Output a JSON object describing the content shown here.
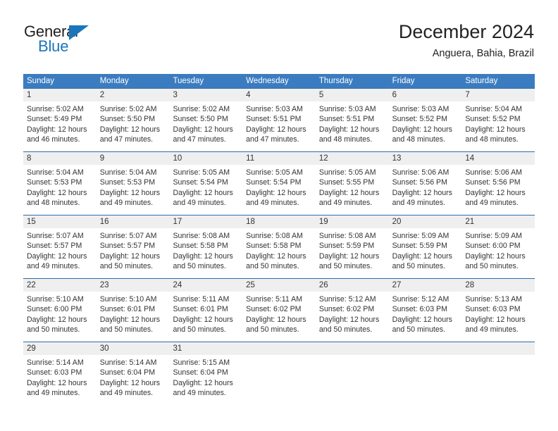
{
  "brand": {
    "name_part1": "General",
    "name_part2": "Blue",
    "triangle_color": "#1b75bb"
  },
  "header": {
    "title": "December 2024",
    "location": "Anguera, Bahia, Brazil"
  },
  "theme": {
    "header_blue": "#3b7cc0",
    "separator_blue": "#2f6cab",
    "daynum_band": "#efefef",
    "text": "#333333"
  },
  "weekdays": [
    "Sunday",
    "Monday",
    "Tuesday",
    "Wednesday",
    "Thursday",
    "Friday",
    "Saturday"
  ],
  "labels": {
    "sunrise_prefix": "Sunrise: ",
    "sunset_prefix": "Sunset: ",
    "daylight_prefix": "Daylight: "
  },
  "weeks": [
    {
      "days": [
        {
          "num": "1",
          "sunrise": "Sunrise: 5:02 AM",
          "sunset": "Sunset: 5:49 PM",
          "daylight_a": "Daylight: 12 hours",
          "daylight_b": "and 46 minutes."
        },
        {
          "num": "2",
          "sunrise": "Sunrise: 5:02 AM",
          "sunset": "Sunset: 5:50 PM",
          "daylight_a": "Daylight: 12 hours",
          "daylight_b": "and 47 minutes."
        },
        {
          "num": "3",
          "sunrise": "Sunrise: 5:02 AM",
          "sunset": "Sunset: 5:50 PM",
          "daylight_a": "Daylight: 12 hours",
          "daylight_b": "and 47 minutes."
        },
        {
          "num": "4",
          "sunrise": "Sunrise: 5:03 AM",
          "sunset": "Sunset: 5:51 PM",
          "daylight_a": "Daylight: 12 hours",
          "daylight_b": "and 47 minutes."
        },
        {
          "num": "5",
          "sunrise": "Sunrise: 5:03 AM",
          "sunset": "Sunset: 5:51 PM",
          "daylight_a": "Daylight: 12 hours",
          "daylight_b": "and 48 minutes."
        },
        {
          "num": "6",
          "sunrise": "Sunrise: 5:03 AM",
          "sunset": "Sunset: 5:52 PM",
          "daylight_a": "Daylight: 12 hours",
          "daylight_b": "and 48 minutes."
        },
        {
          "num": "7",
          "sunrise": "Sunrise: 5:04 AM",
          "sunset": "Sunset: 5:52 PM",
          "daylight_a": "Daylight: 12 hours",
          "daylight_b": "and 48 minutes."
        }
      ]
    },
    {
      "days": [
        {
          "num": "8",
          "sunrise": "Sunrise: 5:04 AM",
          "sunset": "Sunset: 5:53 PM",
          "daylight_a": "Daylight: 12 hours",
          "daylight_b": "and 48 minutes."
        },
        {
          "num": "9",
          "sunrise": "Sunrise: 5:04 AM",
          "sunset": "Sunset: 5:53 PM",
          "daylight_a": "Daylight: 12 hours",
          "daylight_b": "and 49 minutes."
        },
        {
          "num": "10",
          "sunrise": "Sunrise: 5:05 AM",
          "sunset": "Sunset: 5:54 PM",
          "daylight_a": "Daylight: 12 hours",
          "daylight_b": "and 49 minutes."
        },
        {
          "num": "11",
          "sunrise": "Sunrise: 5:05 AM",
          "sunset": "Sunset: 5:54 PM",
          "daylight_a": "Daylight: 12 hours",
          "daylight_b": "and 49 minutes."
        },
        {
          "num": "12",
          "sunrise": "Sunrise: 5:05 AM",
          "sunset": "Sunset: 5:55 PM",
          "daylight_a": "Daylight: 12 hours",
          "daylight_b": "and 49 minutes."
        },
        {
          "num": "13",
          "sunrise": "Sunrise: 5:06 AM",
          "sunset": "Sunset: 5:56 PM",
          "daylight_a": "Daylight: 12 hours",
          "daylight_b": "and 49 minutes."
        },
        {
          "num": "14",
          "sunrise": "Sunrise: 5:06 AM",
          "sunset": "Sunset: 5:56 PM",
          "daylight_a": "Daylight: 12 hours",
          "daylight_b": "and 49 minutes."
        }
      ]
    },
    {
      "days": [
        {
          "num": "15",
          "sunrise": "Sunrise: 5:07 AM",
          "sunset": "Sunset: 5:57 PM",
          "daylight_a": "Daylight: 12 hours",
          "daylight_b": "and 49 minutes."
        },
        {
          "num": "16",
          "sunrise": "Sunrise: 5:07 AM",
          "sunset": "Sunset: 5:57 PM",
          "daylight_a": "Daylight: 12 hours",
          "daylight_b": "and 50 minutes."
        },
        {
          "num": "17",
          "sunrise": "Sunrise: 5:08 AM",
          "sunset": "Sunset: 5:58 PM",
          "daylight_a": "Daylight: 12 hours",
          "daylight_b": "and 50 minutes."
        },
        {
          "num": "18",
          "sunrise": "Sunrise: 5:08 AM",
          "sunset": "Sunset: 5:58 PM",
          "daylight_a": "Daylight: 12 hours",
          "daylight_b": "and 50 minutes."
        },
        {
          "num": "19",
          "sunrise": "Sunrise: 5:08 AM",
          "sunset": "Sunset: 5:59 PM",
          "daylight_a": "Daylight: 12 hours",
          "daylight_b": "and 50 minutes."
        },
        {
          "num": "20",
          "sunrise": "Sunrise: 5:09 AM",
          "sunset": "Sunset: 5:59 PM",
          "daylight_a": "Daylight: 12 hours",
          "daylight_b": "and 50 minutes."
        },
        {
          "num": "21",
          "sunrise": "Sunrise: 5:09 AM",
          "sunset": "Sunset: 6:00 PM",
          "daylight_a": "Daylight: 12 hours",
          "daylight_b": "and 50 minutes."
        }
      ]
    },
    {
      "days": [
        {
          "num": "22",
          "sunrise": "Sunrise: 5:10 AM",
          "sunset": "Sunset: 6:00 PM",
          "daylight_a": "Daylight: 12 hours",
          "daylight_b": "and 50 minutes."
        },
        {
          "num": "23",
          "sunrise": "Sunrise: 5:10 AM",
          "sunset": "Sunset: 6:01 PM",
          "daylight_a": "Daylight: 12 hours",
          "daylight_b": "and 50 minutes."
        },
        {
          "num": "24",
          "sunrise": "Sunrise: 5:11 AM",
          "sunset": "Sunset: 6:01 PM",
          "daylight_a": "Daylight: 12 hours",
          "daylight_b": "and 50 minutes."
        },
        {
          "num": "25",
          "sunrise": "Sunrise: 5:11 AM",
          "sunset": "Sunset: 6:02 PM",
          "daylight_a": "Daylight: 12 hours",
          "daylight_b": "and 50 minutes."
        },
        {
          "num": "26",
          "sunrise": "Sunrise: 5:12 AM",
          "sunset": "Sunset: 6:02 PM",
          "daylight_a": "Daylight: 12 hours",
          "daylight_b": "and 50 minutes."
        },
        {
          "num": "27",
          "sunrise": "Sunrise: 5:12 AM",
          "sunset": "Sunset: 6:03 PM",
          "daylight_a": "Daylight: 12 hours",
          "daylight_b": "and 50 minutes."
        },
        {
          "num": "28",
          "sunrise": "Sunrise: 5:13 AM",
          "sunset": "Sunset: 6:03 PM",
          "daylight_a": "Daylight: 12 hours",
          "daylight_b": "and 49 minutes."
        }
      ]
    },
    {
      "days": [
        {
          "num": "29",
          "sunrise": "Sunrise: 5:14 AM",
          "sunset": "Sunset: 6:03 PM",
          "daylight_a": "Daylight: 12 hours",
          "daylight_b": "and 49 minutes."
        },
        {
          "num": "30",
          "sunrise": "Sunrise: 5:14 AM",
          "sunset": "Sunset: 6:04 PM",
          "daylight_a": "Daylight: 12 hours",
          "daylight_b": "and 49 minutes."
        },
        {
          "num": "31",
          "sunrise": "Sunrise: 5:15 AM",
          "sunset": "Sunset: 6:04 PM",
          "daylight_a": "Daylight: 12 hours",
          "daylight_b": "and 49 minutes."
        },
        {
          "num": "",
          "sunrise": "",
          "sunset": "",
          "daylight_a": "",
          "daylight_b": ""
        },
        {
          "num": "",
          "sunrise": "",
          "sunset": "",
          "daylight_a": "",
          "daylight_b": ""
        },
        {
          "num": "",
          "sunrise": "",
          "sunset": "",
          "daylight_a": "",
          "daylight_b": ""
        },
        {
          "num": "",
          "sunrise": "",
          "sunset": "",
          "daylight_a": "",
          "daylight_b": ""
        }
      ]
    }
  ]
}
